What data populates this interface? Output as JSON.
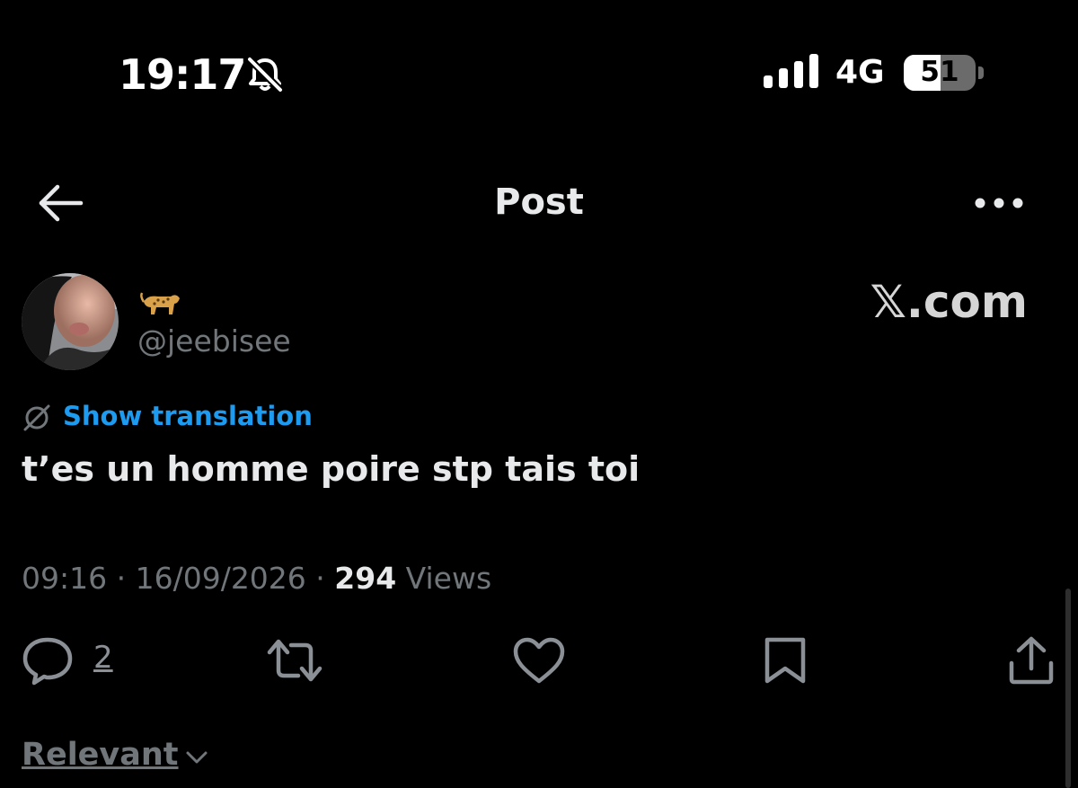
{
  "status_bar": {
    "time": "19:17",
    "network": "4G",
    "battery_level": "51",
    "battery_fraction": 0.51
  },
  "header": {
    "title": "Post",
    "back_icon": "arrow-left-icon",
    "more_icon": "more-horizontal-icon"
  },
  "author": {
    "handle": "@jeebisee",
    "display_name_icon": "leopard-emoji"
  },
  "watermark": "𝕏.com",
  "tweet": {
    "translation_label": "Show translation",
    "text": "t’es un homme poire stp tais toi",
    "time": "09:16",
    "separator": " · ",
    "date": "16/09/2026",
    "views_count": "294",
    "views_label": " Views"
  },
  "actions": {
    "reply_count": "2",
    "icons": [
      "reply-icon",
      "retweet-icon",
      "like-icon",
      "bookmark-icon",
      "share-icon"
    ]
  },
  "replies_sort": {
    "label": "Relevant"
  },
  "colors": {
    "background": "#000000",
    "text": "#e7e9ea",
    "muted": "#71767b",
    "link": "#1d9bf0"
  }
}
